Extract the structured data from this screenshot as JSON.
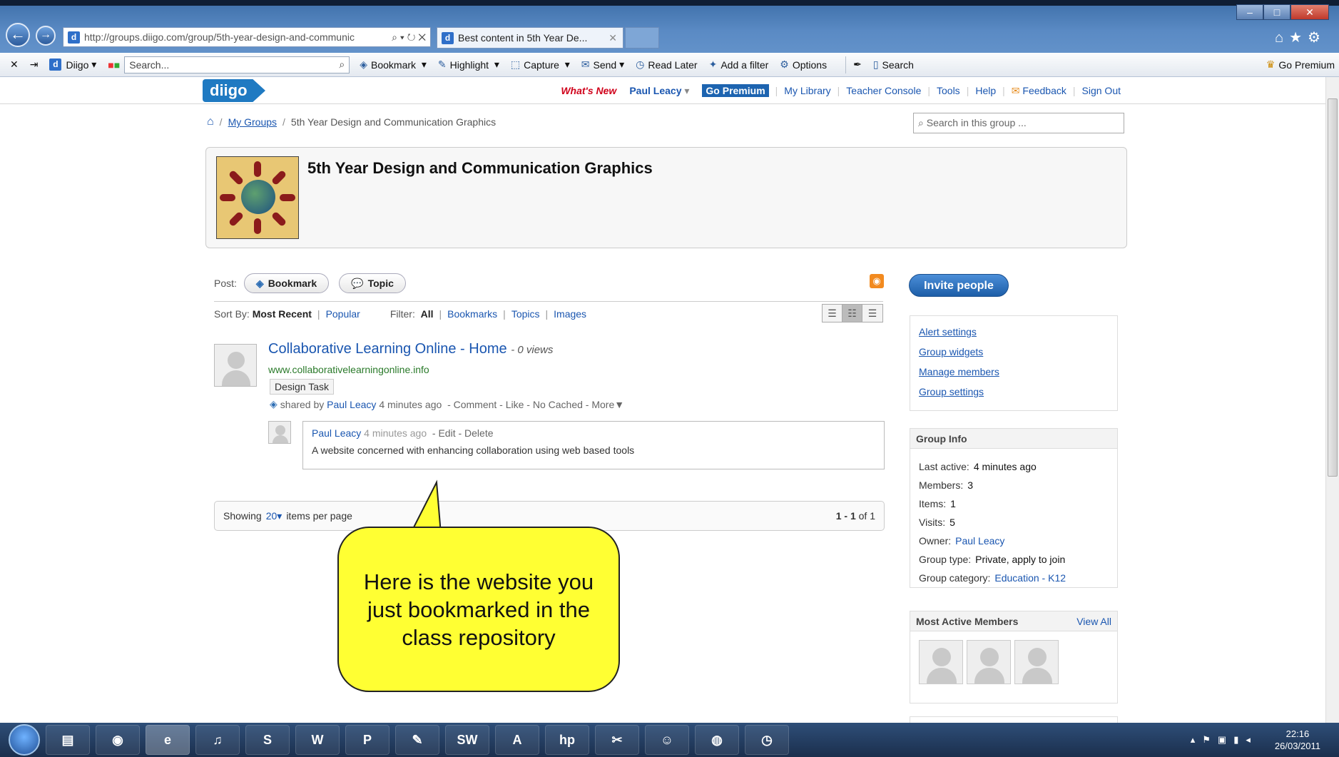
{
  "browser": {
    "url": "http://groups.diigo.com/group/5th-year-design-and-communic",
    "tab_title": "Best content in 5th Year De...",
    "favicon": "d"
  },
  "toolbar": {
    "diigo": "Diigo",
    "search_placeholder": "Search...",
    "bookmark": "Bookmark",
    "highlight": "Highlight",
    "capture": "Capture",
    "send": "Send",
    "read_later": "Read Later",
    "add_filter": "Add a filter",
    "options": "Options",
    "search": "Search",
    "go_premium": "Go Premium"
  },
  "site": {
    "logo": "diigo",
    "nav": {
      "whats_new": "What's New",
      "user": "Paul Leacy",
      "premium": "Go Premium",
      "library": "My Library",
      "teacher": "Teacher Console",
      "tools": "Tools",
      "help": "Help",
      "feedback": "Feedback",
      "signout": "Sign Out"
    }
  },
  "breadcrumb": {
    "groups": "My Groups",
    "current": "5th Year Design and Communication Graphics"
  },
  "group_search_placeholder": "Search in this group ...",
  "group": {
    "title": "5th Year Design and Communication Graphics"
  },
  "post": {
    "label": "Post:",
    "bookmark": "Bookmark",
    "topic": "Topic"
  },
  "sort": {
    "label": "Sort By:",
    "recent": "Most Recent",
    "popular": "Popular",
    "filter_label": "Filter:",
    "all": "All",
    "bookmarks": "Bookmarks",
    "topics": "Topics",
    "images": "Images"
  },
  "item": {
    "title": "Collaborative Learning Online - Home",
    "views": "- 0 views",
    "url": "www.collaborativelearningonline.info",
    "tag": "Design Task",
    "shared_by": "shared by",
    "user": "Paul Leacy",
    "time": "4 minutes ago",
    "actions": "- Comment - Like - No Cached - More▼",
    "comment": {
      "user": "Paul Leacy",
      "time": "4 minutes ago",
      "actions": "- Edit - Delete",
      "text": "A website concerned with enhancing collaboration using web based tools"
    }
  },
  "pager": {
    "showing": "Showing",
    "count": "20▾",
    "per_page": "items per page",
    "range": "1 - 1",
    "of": "of 1"
  },
  "callout": "Here is the website you just bookmarked in the class repository",
  "sidebar": {
    "invite": "Invite people",
    "links": [
      "Alert settings",
      "Group widgets",
      "Manage members",
      "Group settings"
    ],
    "info_title": "Group Info",
    "info": {
      "last_active_k": "Last active:",
      "last_active_v": "4 minutes ago",
      "members_k": "Members:",
      "members_v": "3",
      "items_k": "Items:",
      "items_v": "1",
      "visits_k": "Visits:",
      "visits_v": "5",
      "owner_k": "Owner:",
      "owner_v": "Paul Leacy",
      "type_k": "Group type:",
      "type_v": "Private, apply to join",
      "category_k": "Group category:",
      "category_v": "Education - K12"
    },
    "members_title": "Most Active Members",
    "view_all": "View All"
  },
  "taskbar": {
    "time": "22:16",
    "date": "26/03/2011"
  }
}
